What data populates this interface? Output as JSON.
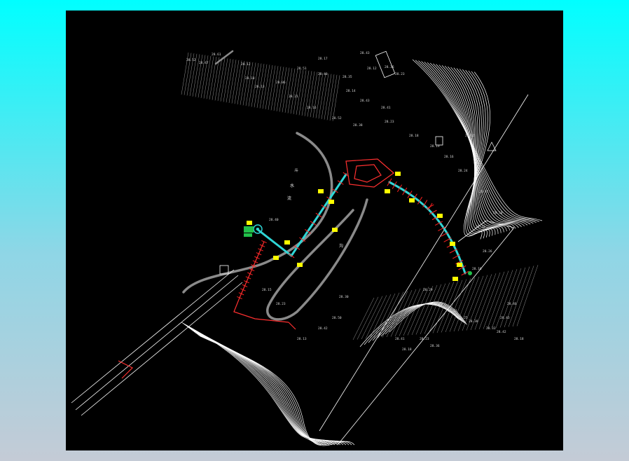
{
  "drawing": {
    "colors": {
      "page_background_top": "#00ffff",
      "page_background_bottom": "#c4cbd6",
      "viewport": "#000000",
      "contour": "#ffffff",
      "road": "#8a8a8a",
      "pipe": "#2fd6d6",
      "section": "#ff2020",
      "tag": "#ffff00",
      "node": "#22c04a"
    },
    "icons": [
      "station-marker-icon",
      "outlet-marker-icon",
      "north-arrow-icon"
    ],
    "elevation_labels": [
      "28.52",
      "28.47",
      "28.61",
      "28.12",
      "28.18",
      "28.13",
      "28.06",
      "28.21",
      "28.16",
      "28.17",
      "28.51",
      "28.40",
      "28.35",
      "28.43",
      "28.12",
      "28.36",
      "28.23",
      "28.14",
      "28.43",
      "28.41",
      "28.52",
      "28.38",
      "28.23",
      "28.18",
      "28.19",
      "28.16",
      "28.12",
      "28.24",
      "28.41",
      "28.50",
      "28.33",
      "28.26",
      "28.16",
      "28.29",
      "28.09",
      "28.11",
      "28.25",
      "28.38",
      "28.33",
      "28.42",
      "28.18",
      "28.46",
      "28.43",
      "28.23",
      "28.36",
      "28.41",
      "28.18",
      "28.30",
      "28.50",
      "28.15",
      "28.23",
      "28.42",
      "28.13",
      "28.40"
    ],
    "annotations": [
      "斗",
      "水",
      "流",
      "沟"
    ]
  }
}
